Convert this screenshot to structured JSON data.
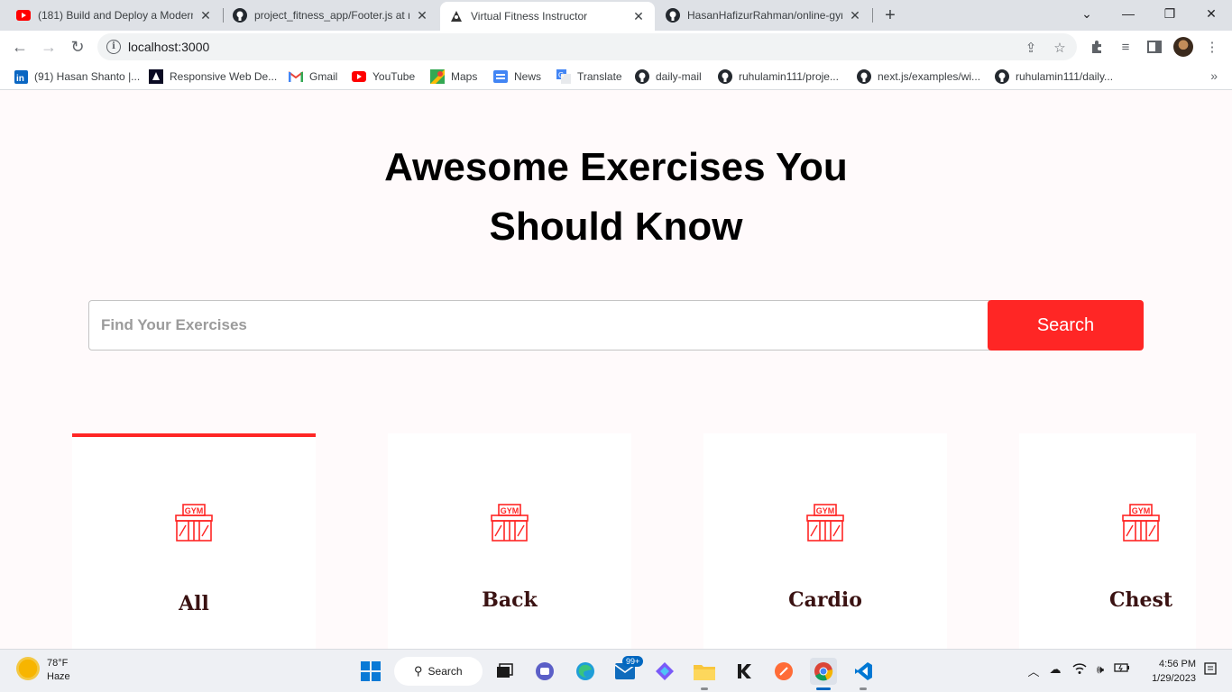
{
  "browser": {
    "tabs": [
      {
        "title": "(181) Build and Deploy a Modern",
        "icon": "youtube-icon"
      },
      {
        "title": "project_fitness_app/Footer.js at m",
        "icon": "github-icon"
      },
      {
        "title": "Virtual Fitness Instructor",
        "icon": "app-icon",
        "active": true
      },
      {
        "title": "HasanHafizurRahman/online-gym",
        "icon": "github-icon"
      }
    ],
    "url": "localhost:3000",
    "bookmarks": [
      {
        "label": "(91) Hasan Shanto |...",
        "icon": "linkedin-icon"
      },
      {
        "label": "Responsive Web De...",
        "icon": "freecodecamp-icon"
      },
      {
        "label": "Gmail",
        "icon": "gmail-icon"
      },
      {
        "label": "YouTube",
        "icon": "youtube-icon"
      },
      {
        "label": "Maps",
        "icon": "maps-icon"
      },
      {
        "label": "News",
        "icon": "news-icon"
      },
      {
        "label": "Translate",
        "icon": "translate-icon"
      },
      {
        "label": "daily-mail",
        "icon": "github-icon"
      },
      {
        "label": "ruhulamin111/proje...",
        "icon": "github-icon"
      },
      {
        "label": "next.js/examples/wi...",
        "icon": "github-icon"
      },
      {
        "label": "ruhulamin111/daily...",
        "icon": "github-icon"
      }
    ]
  },
  "hero": {
    "title_line1": "Awesome Exercises You",
    "title_line2": "Should Know"
  },
  "search": {
    "placeholder": "Find Your Exercises",
    "button_label": "Search"
  },
  "body_parts": [
    {
      "label": "All",
      "active": true
    },
    {
      "label": "Back",
      "active": false
    },
    {
      "label": "Cardio",
      "active": false
    },
    {
      "label": "Chest",
      "active": false
    }
  ],
  "gym_icon_text": "GYM",
  "taskbar": {
    "weather_temp": "78°F",
    "weather_desc": "Haze",
    "search_label": "Search",
    "mail_badge": "99+",
    "time": "4:56 PM",
    "date": "1/29/2023"
  },
  "colors": {
    "accent": "#ff2625",
    "page_bg": "#fffafb",
    "label_text": "#3a1212"
  }
}
